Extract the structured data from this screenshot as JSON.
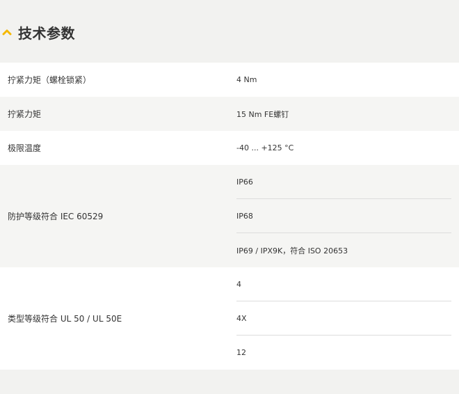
{
  "section": {
    "title": "技术参数",
    "icon": "chevron-up-icon",
    "accent_color": "#f5b800"
  },
  "specs": [
    {
      "label": "拧紧力矩（螺栓锁紧）",
      "values": [
        " 4 Nm"
      ]
    },
    {
      "label": "拧紧力矩",
      "values": [
        "15 Nm FE螺钉"
      ]
    },
    {
      "label": "极限温度",
      "values": [
        "-40 ... +125 °C"
      ]
    },
    {
      "label": "防护等级符合 IEC 60529",
      "values": [
        "IP66",
        "IP68",
        "IP69 / IPX9K，符合 ISO 20653"
      ]
    },
    {
      "label": "类型等级符合 UL 50 / UL 50E",
      "values": [
        "4",
        "4X",
        "12"
      ]
    }
  ]
}
